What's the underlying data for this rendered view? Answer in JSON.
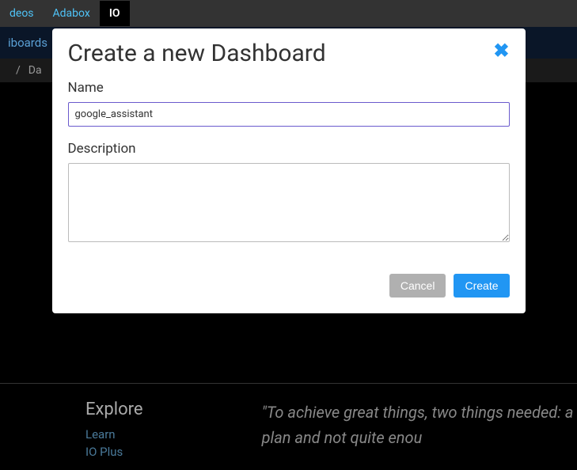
{
  "topNav": {
    "items": [
      {
        "label": "deos"
      },
      {
        "label": "Adabox"
      },
      {
        "label": "IO"
      }
    ]
  },
  "subNav": {
    "items": [
      {
        "label": "iboards"
      }
    ]
  },
  "breadcrumb": {
    "sep": "/",
    "current": "Da"
  },
  "modal": {
    "title": "Create a new Dashboard",
    "nameLabel": "Name",
    "nameValue": "google_assistant",
    "descLabel": "Description",
    "descValue": "",
    "cancel": "Cancel",
    "create": "Create"
  },
  "footer": {
    "heading": "Explore",
    "links": [
      {
        "label": "Learn"
      },
      {
        "label": "IO Plus"
      }
    ],
    "quote": "\"To achieve great things, two things needed: a plan and not quite enou"
  }
}
